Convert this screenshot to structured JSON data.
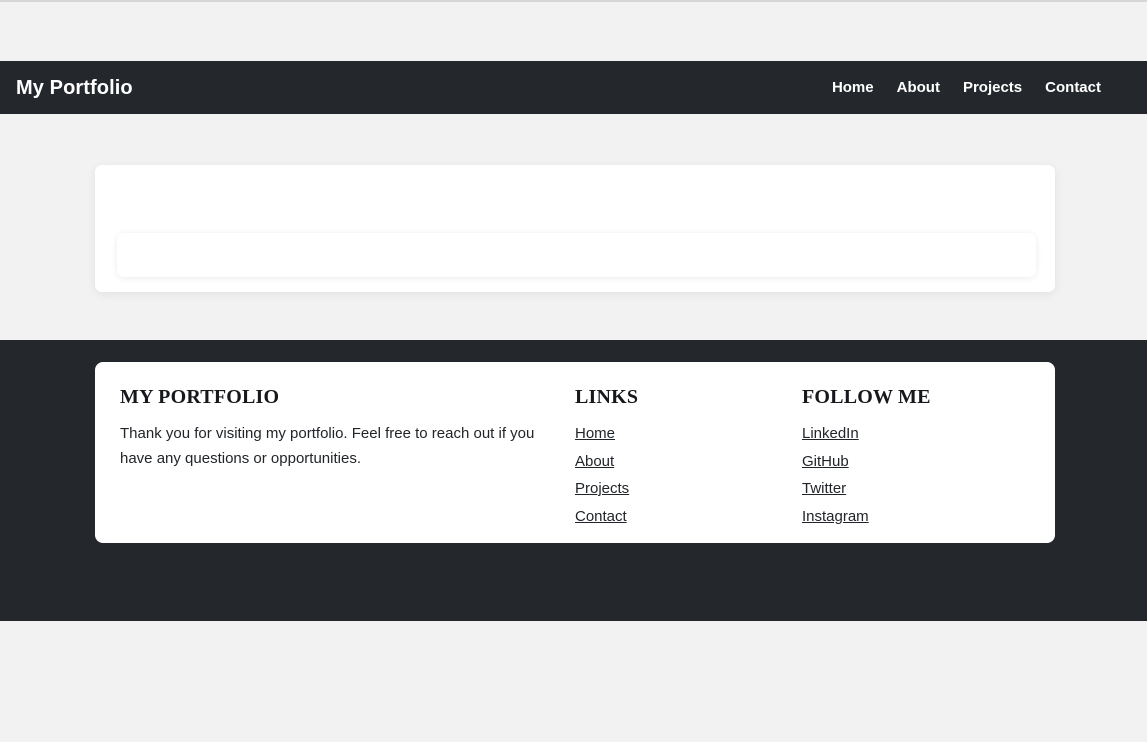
{
  "page": {
    "background_color": "#f2f2f3",
    "dark_color": "#24272c"
  },
  "navbar": {
    "brand": "My Portfolio",
    "links": [
      {
        "label": "Home"
      },
      {
        "label": "About"
      },
      {
        "label": "Projects"
      },
      {
        "label": "Contact"
      }
    ]
  },
  "main": {
    "card": {
      "empty": true,
      "inner_box_empty": true
    }
  },
  "footer": {
    "about": {
      "heading": "MY PORTFOLIO",
      "text": "Thank you for visiting my portfolio. Feel free to reach out if you have any questions or opportunities."
    },
    "links": {
      "heading": "LINKS",
      "items": [
        {
          "label": "Home"
        },
        {
          "label": "About"
        },
        {
          "label": "Projects"
        },
        {
          "label": "Contact"
        }
      ]
    },
    "social": {
      "heading": "FOLLOW ME",
      "items": [
        {
          "label": "LinkedIn"
        },
        {
          "label": "GitHub"
        },
        {
          "label": "Twitter"
        },
        {
          "label": "Instagram"
        }
      ]
    }
  }
}
